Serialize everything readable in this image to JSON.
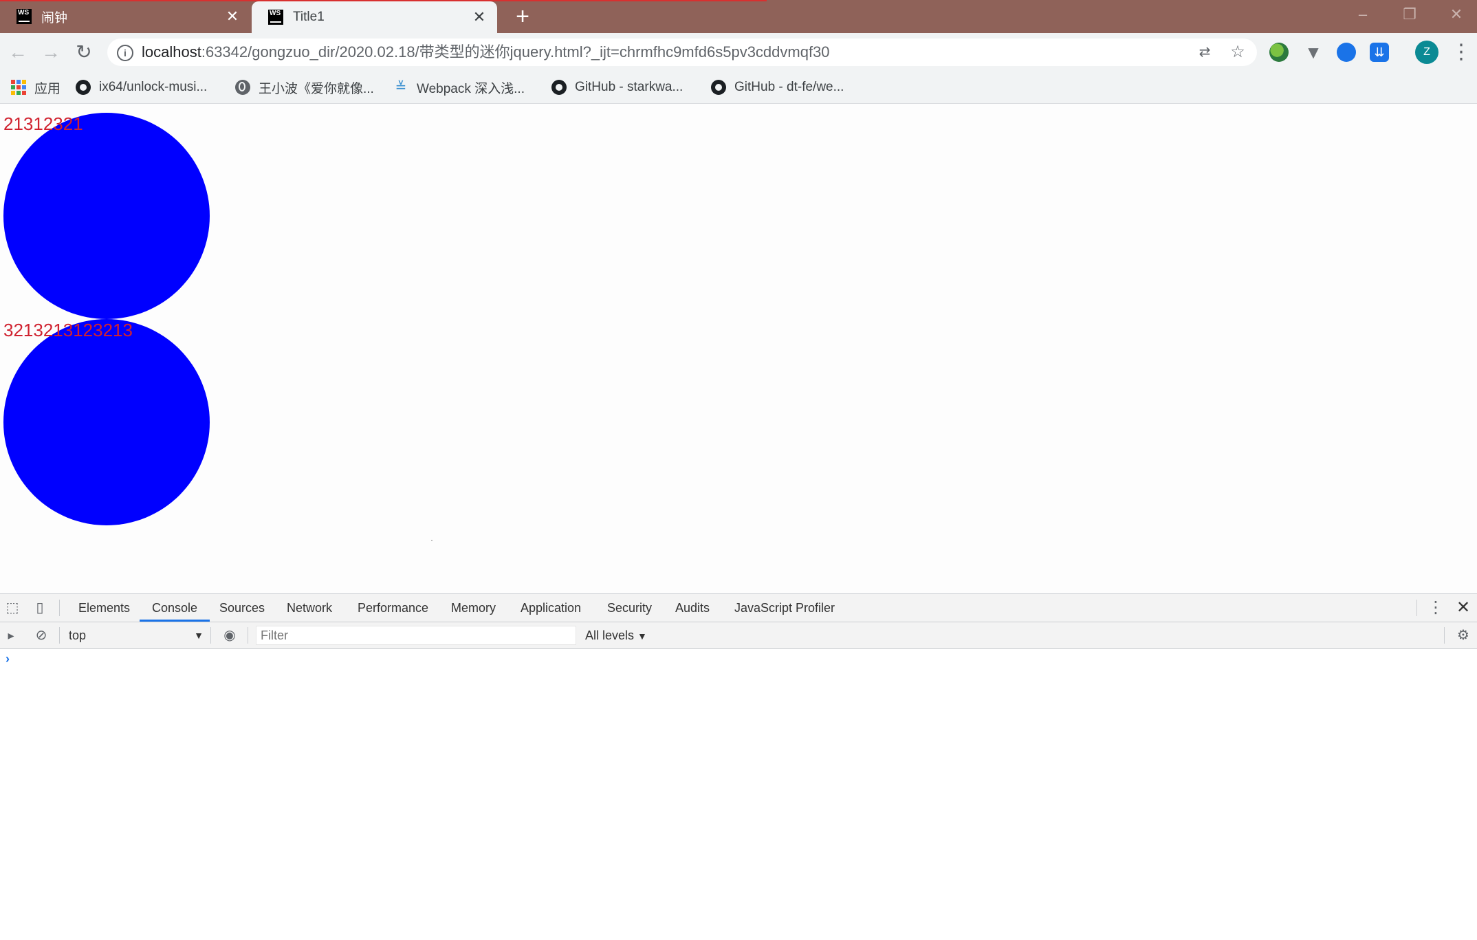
{
  "browser": {
    "tabs": [
      {
        "title": "闹钟",
        "active": false,
        "icon": "webstorm-icon"
      },
      {
        "title": "Title1",
        "active": true,
        "icon": "webstorm-icon"
      }
    ],
    "ws_icon_text": "WS",
    "address": {
      "host": "localhost",
      "rest": ":63342/gongzuo_dir/2020.02.18/带类型的迷你jquery.html?_ijt=chrmfhc9mfd6s5pv3cddvmqf30"
    },
    "profile_initial": "Z"
  },
  "bookmarks": [
    {
      "label": "应用",
      "icon": "apps-grid-icon"
    },
    {
      "label": "ix64/unlock-musi...",
      "icon": "github-icon"
    },
    {
      "label": "王小波《爱你就像...",
      "icon": "globe-icon"
    },
    {
      "label": "Webpack 深入浅...",
      "icon": "webpack-icon"
    },
    {
      "label": "GitHub - starkwa...",
      "icon": "github-icon"
    },
    {
      "label": "GitHub - dt-fe/we...",
      "icon": "github-icon"
    }
  ],
  "page": {
    "items": [
      {
        "label": "21312321",
        "color": "#0000ff"
      },
      {
        "label": "3213213123213",
        "color": "#0000ff"
      }
    ],
    "label_color": "#d0222f"
  },
  "devtools": {
    "tabs": [
      "Elements",
      "Console",
      "Sources",
      "Network",
      "Performance",
      "Memory",
      "Application",
      "Security",
      "Audits",
      "JavaScript Profiler"
    ],
    "active_tab": "Console",
    "context": "top",
    "filter_placeholder": "Filter",
    "levels": "All levels",
    "prompt": "›"
  }
}
